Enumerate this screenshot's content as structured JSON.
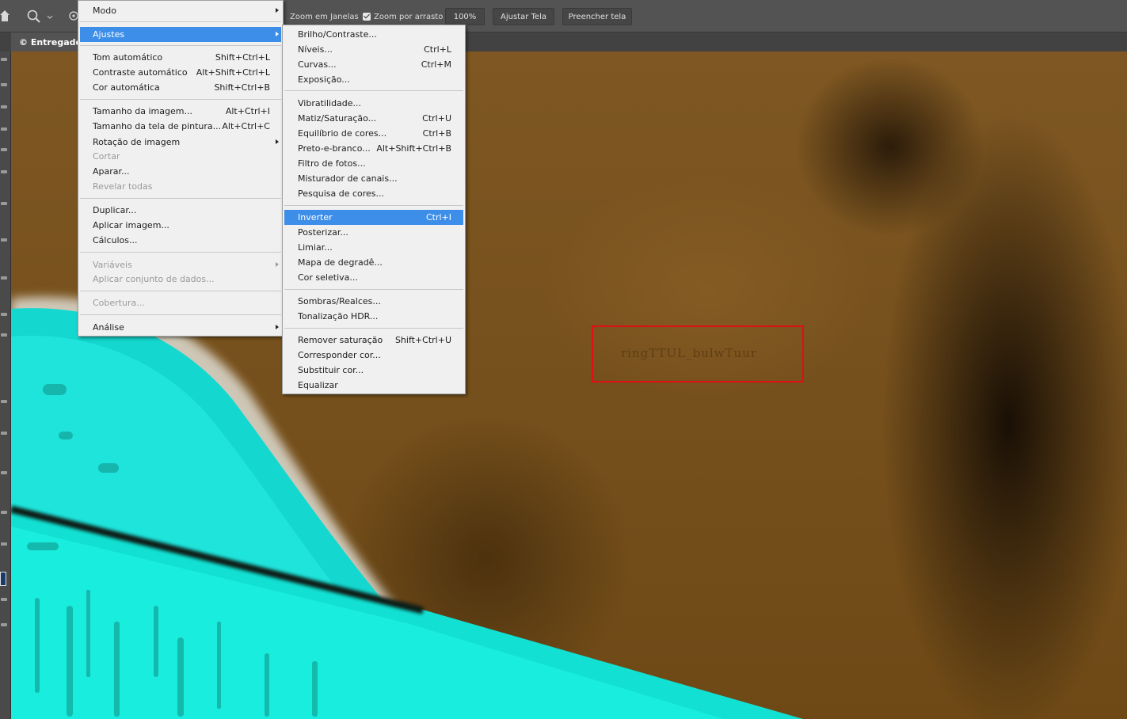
{
  "options_bar": {
    "zoom_all_windows": "Zoom em Janelas",
    "scrubby_zoom": "Zoom por arrasto",
    "zoom_level": "100%",
    "fit_screen": "Ajustar Tela",
    "fill_screen": "Preencher tela",
    "icons": [
      "home-icon",
      "magnifier-icon",
      "chevron-down-icon",
      "zoom-in-icon"
    ]
  },
  "document_tab": {
    "title": "© Entregador."
  },
  "canvas": {
    "watermark_text": "ringTTUL_bulwTuur",
    "highlight_color": "#e01010"
  },
  "main_menu": {
    "items": [
      {
        "label": "Modo",
        "shortcut": "",
        "submenu": true,
        "disabled": false
      },
      {
        "label": "Ajustes",
        "shortcut": "",
        "submenu": true,
        "disabled": false,
        "highlighted": true
      },
      {
        "label": "Tom automático",
        "shortcut": "Shift+Ctrl+L",
        "disabled": false
      },
      {
        "label": "Contraste automático",
        "shortcut": "Alt+Shift+Ctrl+L",
        "disabled": false
      },
      {
        "label": "Cor automática",
        "shortcut": "Shift+Ctrl+B",
        "disabled": false
      },
      {
        "label": "Tamanho da imagem...",
        "shortcut": "Alt+Ctrl+I",
        "disabled": false
      },
      {
        "label": "Tamanho da tela de pintura...",
        "shortcut": "Alt+Ctrl+C",
        "disabled": false
      },
      {
        "label": "Rotação de imagem",
        "shortcut": "",
        "submenu": true,
        "disabled": false
      },
      {
        "label": "Cortar",
        "shortcut": "",
        "disabled": true
      },
      {
        "label": "Aparar...",
        "shortcut": "",
        "disabled": false
      },
      {
        "label": "Revelar todas",
        "shortcut": "",
        "disabled": true
      },
      {
        "label": "Duplicar...",
        "shortcut": "",
        "disabled": false
      },
      {
        "label": "Aplicar imagem...",
        "shortcut": "",
        "disabled": false
      },
      {
        "label": "Cálculos...",
        "shortcut": "",
        "disabled": false
      },
      {
        "label": "Variáveis",
        "shortcut": "",
        "submenu": true,
        "disabled": true
      },
      {
        "label": "Aplicar conjunto de dados...",
        "shortcut": "",
        "disabled": true
      },
      {
        "label": "Cobertura...",
        "shortcut": "",
        "disabled": true
      },
      {
        "label": "Análise",
        "shortcut": "",
        "submenu": true,
        "disabled": false
      }
    ]
  },
  "submenu": {
    "items": [
      {
        "label": "Brilho/Contraste...",
        "shortcut": ""
      },
      {
        "label": "Níveis...",
        "shortcut": "Ctrl+L"
      },
      {
        "label": "Curvas...",
        "shortcut": "Ctrl+M"
      },
      {
        "label": "Exposição...",
        "shortcut": ""
      },
      {
        "label": "Vibratilidade...",
        "shortcut": ""
      },
      {
        "label": "Matiz/Saturação...",
        "shortcut": "Ctrl+U"
      },
      {
        "label": "Equilíbrio de cores...",
        "shortcut": "Ctrl+B"
      },
      {
        "label": "Preto-e-branco...",
        "shortcut": "Alt+Shift+Ctrl+B"
      },
      {
        "label": "Filtro de fotos...",
        "shortcut": ""
      },
      {
        "label": "Misturador de canais...",
        "shortcut": ""
      },
      {
        "label": "Pesquisa de cores...",
        "shortcut": ""
      },
      {
        "label": "Inverter",
        "shortcut": "Ctrl+I",
        "highlighted": true
      },
      {
        "label": "Posterizar...",
        "shortcut": ""
      },
      {
        "label": "Limiar...",
        "shortcut": ""
      },
      {
        "label": "Mapa de degradê...",
        "shortcut": ""
      },
      {
        "label": "Cor seletiva...",
        "shortcut": ""
      },
      {
        "label": "Sombras/Realces...",
        "shortcut": ""
      },
      {
        "label": "Tonalização HDR...",
        "shortcut": ""
      },
      {
        "label": "Remover saturação",
        "shortcut": "Shift+Ctrl+U"
      },
      {
        "label": "Corresponder cor...",
        "shortcut": ""
      },
      {
        "label": "Substituir cor...",
        "shortcut": ""
      },
      {
        "label": "Equalizar",
        "shortcut": ""
      }
    ]
  }
}
